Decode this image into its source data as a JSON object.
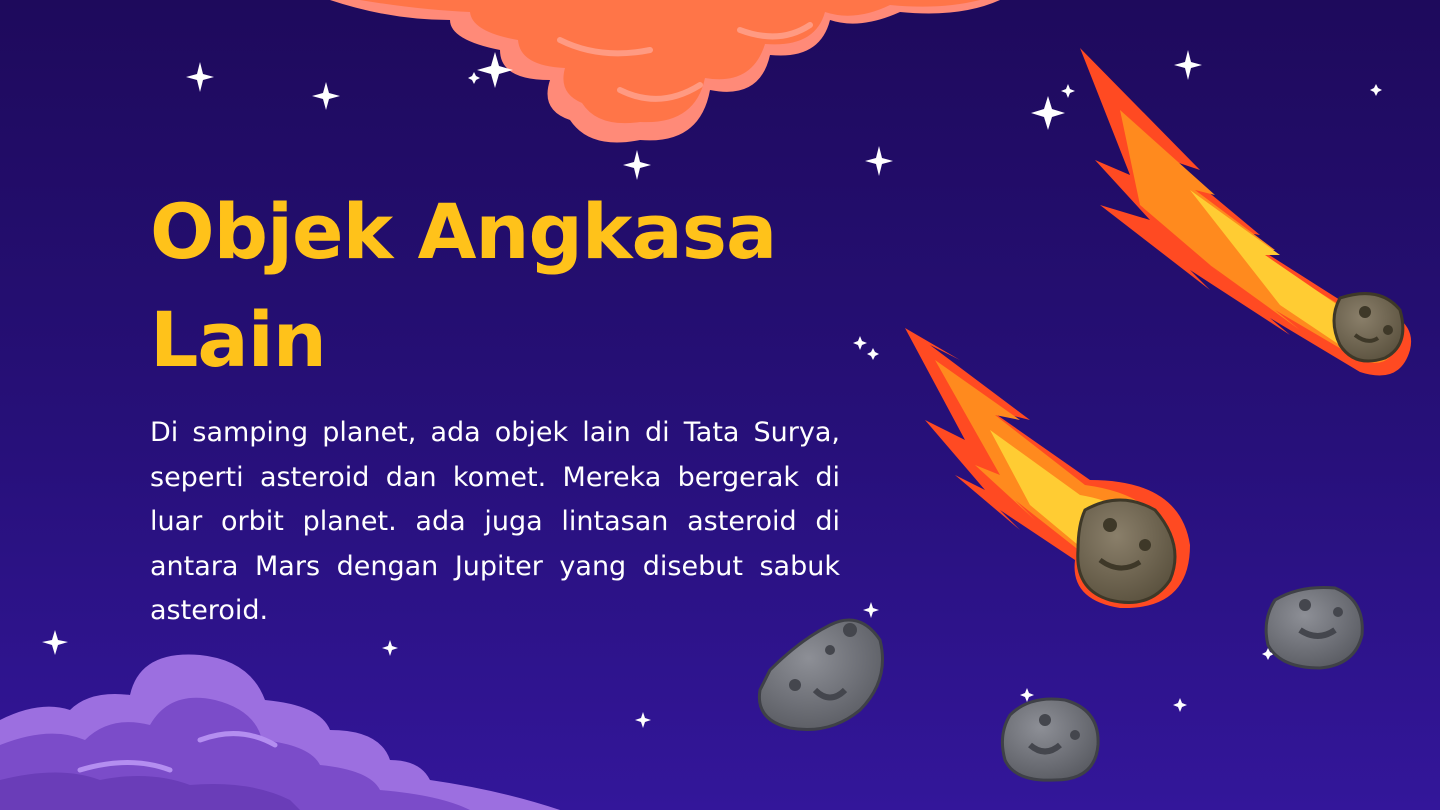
{
  "slide": {
    "title_line1": "Objek Angkasa",
    "title_line2": "Lain",
    "body": "Di samping planet, ada objek lain di Tata Surya, seperti asteroid dan komet. Mereka bergerak di luar orbit planet. ada juga lintasan asteroid di antara Mars dengan Jupiter yang disebut sabuk asteroid."
  },
  "colors": {
    "background_top": "#1e0a5c",
    "background_bottom": "#33169a",
    "title": "#ffc21a",
    "body_text": "#ffffff",
    "cloud_top": "#ff7a5a",
    "cloud_bottom": "#8a5ad8",
    "meteor_fire": "#ff5a2a",
    "asteroid": "#6b6e75"
  },
  "icons": [
    "orange-cloud-icon",
    "purple-cloud-icon",
    "meteor-icon",
    "asteroid-icon",
    "star-icon"
  ]
}
